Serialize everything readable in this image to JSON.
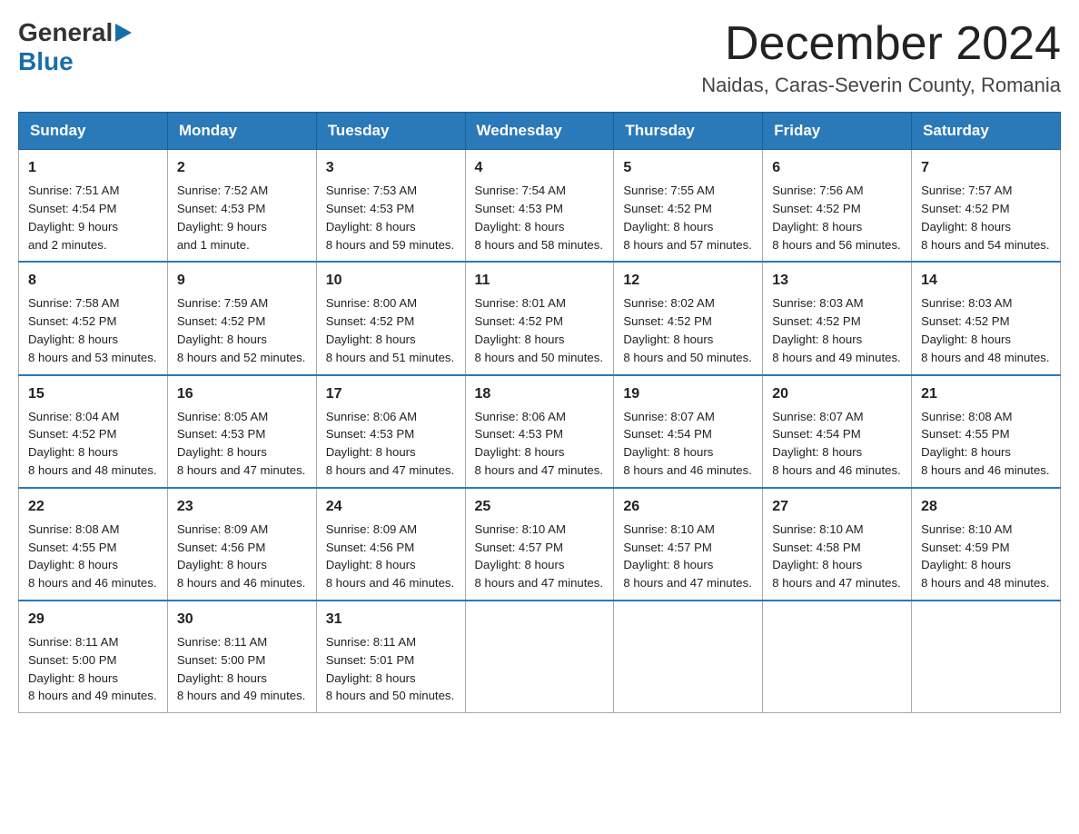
{
  "header": {
    "logo_general": "General",
    "logo_blue": "Blue",
    "month_title": "December 2024",
    "location": "Naidas, Caras-Severin County, Romania"
  },
  "days_of_week": [
    "Sunday",
    "Monday",
    "Tuesday",
    "Wednesday",
    "Thursday",
    "Friday",
    "Saturday"
  ],
  "weeks": [
    [
      {
        "day": "1",
        "sunrise": "7:51 AM",
        "sunset": "4:54 PM",
        "daylight": "9 hours and 2 minutes."
      },
      {
        "day": "2",
        "sunrise": "7:52 AM",
        "sunset": "4:53 PM",
        "daylight": "9 hours and 1 minute."
      },
      {
        "day": "3",
        "sunrise": "7:53 AM",
        "sunset": "4:53 PM",
        "daylight": "8 hours and 59 minutes."
      },
      {
        "day": "4",
        "sunrise": "7:54 AM",
        "sunset": "4:53 PM",
        "daylight": "8 hours and 58 minutes."
      },
      {
        "day": "5",
        "sunrise": "7:55 AM",
        "sunset": "4:52 PM",
        "daylight": "8 hours and 57 minutes."
      },
      {
        "day": "6",
        "sunrise": "7:56 AM",
        "sunset": "4:52 PM",
        "daylight": "8 hours and 56 minutes."
      },
      {
        "day": "7",
        "sunrise": "7:57 AM",
        "sunset": "4:52 PM",
        "daylight": "8 hours and 54 minutes."
      }
    ],
    [
      {
        "day": "8",
        "sunrise": "7:58 AM",
        "sunset": "4:52 PM",
        "daylight": "8 hours and 53 minutes."
      },
      {
        "day": "9",
        "sunrise": "7:59 AM",
        "sunset": "4:52 PM",
        "daylight": "8 hours and 52 minutes."
      },
      {
        "day": "10",
        "sunrise": "8:00 AM",
        "sunset": "4:52 PM",
        "daylight": "8 hours and 51 minutes."
      },
      {
        "day": "11",
        "sunrise": "8:01 AM",
        "sunset": "4:52 PM",
        "daylight": "8 hours and 50 minutes."
      },
      {
        "day": "12",
        "sunrise": "8:02 AM",
        "sunset": "4:52 PM",
        "daylight": "8 hours and 50 minutes."
      },
      {
        "day": "13",
        "sunrise": "8:03 AM",
        "sunset": "4:52 PM",
        "daylight": "8 hours and 49 minutes."
      },
      {
        "day": "14",
        "sunrise": "8:03 AM",
        "sunset": "4:52 PM",
        "daylight": "8 hours and 48 minutes."
      }
    ],
    [
      {
        "day": "15",
        "sunrise": "8:04 AM",
        "sunset": "4:52 PM",
        "daylight": "8 hours and 48 minutes."
      },
      {
        "day": "16",
        "sunrise": "8:05 AM",
        "sunset": "4:53 PM",
        "daylight": "8 hours and 47 minutes."
      },
      {
        "day": "17",
        "sunrise": "8:06 AM",
        "sunset": "4:53 PM",
        "daylight": "8 hours and 47 minutes."
      },
      {
        "day": "18",
        "sunrise": "8:06 AM",
        "sunset": "4:53 PM",
        "daylight": "8 hours and 47 minutes."
      },
      {
        "day": "19",
        "sunrise": "8:07 AM",
        "sunset": "4:54 PM",
        "daylight": "8 hours and 46 minutes."
      },
      {
        "day": "20",
        "sunrise": "8:07 AM",
        "sunset": "4:54 PM",
        "daylight": "8 hours and 46 minutes."
      },
      {
        "day": "21",
        "sunrise": "8:08 AM",
        "sunset": "4:55 PM",
        "daylight": "8 hours and 46 minutes."
      }
    ],
    [
      {
        "day": "22",
        "sunrise": "8:08 AM",
        "sunset": "4:55 PM",
        "daylight": "8 hours and 46 minutes."
      },
      {
        "day": "23",
        "sunrise": "8:09 AM",
        "sunset": "4:56 PM",
        "daylight": "8 hours and 46 minutes."
      },
      {
        "day": "24",
        "sunrise": "8:09 AM",
        "sunset": "4:56 PM",
        "daylight": "8 hours and 46 minutes."
      },
      {
        "day": "25",
        "sunrise": "8:10 AM",
        "sunset": "4:57 PM",
        "daylight": "8 hours and 47 minutes."
      },
      {
        "day": "26",
        "sunrise": "8:10 AM",
        "sunset": "4:57 PM",
        "daylight": "8 hours and 47 minutes."
      },
      {
        "day": "27",
        "sunrise": "8:10 AM",
        "sunset": "4:58 PM",
        "daylight": "8 hours and 47 minutes."
      },
      {
        "day": "28",
        "sunrise": "8:10 AM",
        "sunset": "4:59 PM",
        "daylight": "8 hours and 48 minutes."
      }
    ],
    [
      {
        "day": "29",
        "sunrise": "8:11 AM",
        "sunset": "5:00 PM",
        "daylight": "8 hours and 49 minutes."
      },
      {
        "day": "30",
        "sunrise": "8:11 AM",
        "sunset": "5:00 PM",
        "daylight": "8 hours and 49 minutes."
      },
      {
        "day": "31",
        "sunrise": "8:11 AM",
        "sunset": "5:01 PM",
        "daylight": "8 hours and 50 minutes."
      },
      null,
      null,
      null,
      null
    ]
  ],
  "labels": {
    "sunrise": "Sunrise:",
    "sunset": "Sunset:",
    "daylight": "Daylight:"
  }
}
